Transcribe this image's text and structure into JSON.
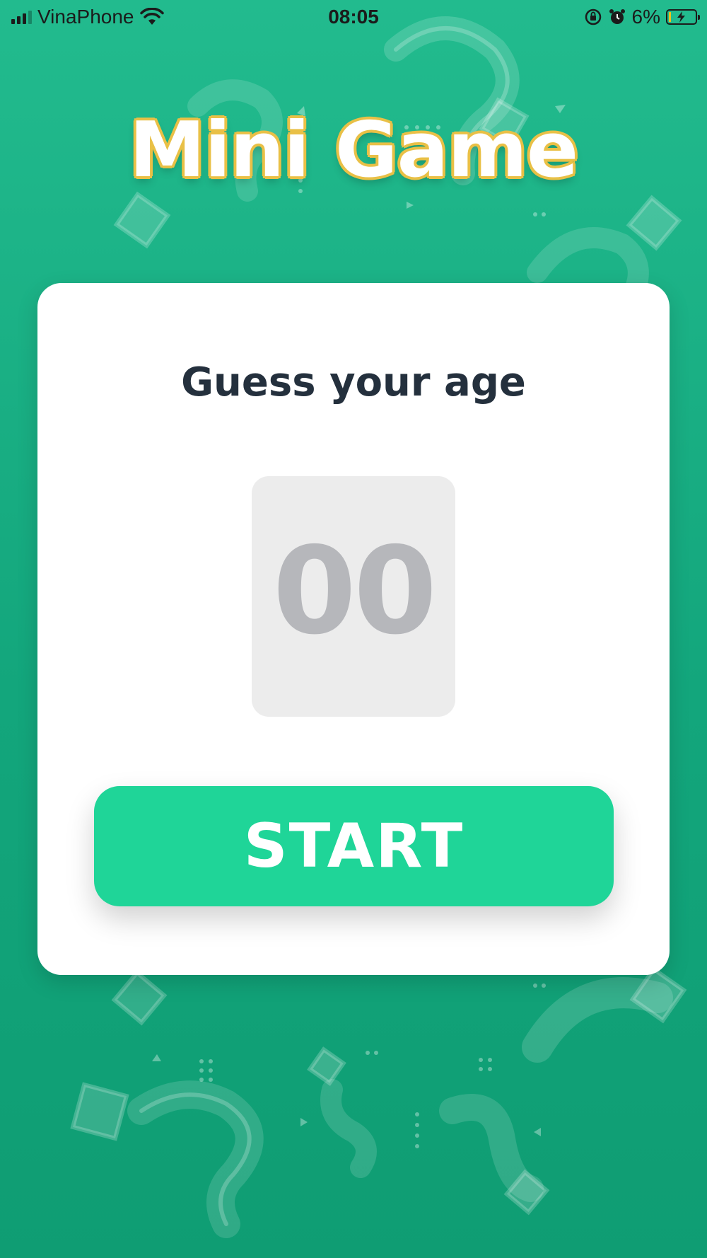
{
  "status_bar": {
    "carrier": "VinaPhone",
    "time": "08:05",
    "battery_percent": "6%",
    "icons": [
      "signal-icon",
      "wifi-icon",
      "orientation-lock-icon",
      "alarm-icon",
      "battery-icon"
    ]
  },
  "title": "Mini Game",
  "card": {
    "heading": "Guess your age",
    "age_value": "00",
    "start_label": "START"
  },
  "colors": {
    "background": "#13a67c",
    "title_outline": "#e9c046",
    "button": "#1fd598",
    "heading_text": "#24303d",
    "age_box": "#ececec",
    "age_text": "#b6b7bb"
  }
}
